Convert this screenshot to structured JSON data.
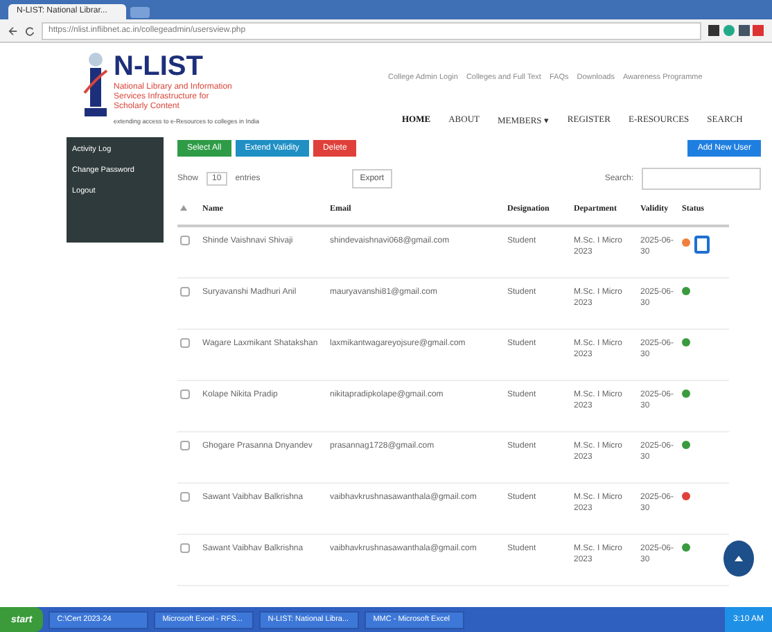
{
  "browser": {
    "tab_title": "N-LIST: National Librar...",
    "url": "https://nlist.inflibnet.ac.in/collegeadmin/usersview.php"
  },
  "header": {
    "logo_title": "N-LIST",
    "logo_subtitle": "National Library and Information Services Infrastructure for Scholarly Content",
    "tagline": "extending access to e-Resources to colleges in India",
    "top_links": [
      "College Admin Login",
      "Colleges and Full Text",
      "FAQs",
      "Downloads",
      "Awareness Programme"
    ],
    "nav": [
      {
        "label": "HOME",
        "selected": true
      },
      {
        "label": "ABOUT",
        "selected": false
      },
      {
        "label": "MEMBERS ▾",
        "selected": false
      },
      {
        "label": "REGISTER",
        "selected": false
      },
      {
        "label": "E-RESOURCES",
        "selected": false
      },
      {
        "label": "SEARCH",
        "selected": false
      }
    ]
  },
  "sidebar": {
    "items": [
      {
        "label": "Activity Log"
      },
      {
        "label": "Change Password"
      },
      {
        "label": "Logout"
      }
    ]
  },
  "actions": [
    {
      "label": "Select All",
      "color": "#2e9c46"
    },
    {
      "label": "Extend Validity",
      "color": "#1f8fc4"
    },
    {
      "label": "Delete",
      "color": "#e0403a"
    }
  ],
  "add_button": "Add New User",
  "show_entries": {
    "prefix": "Show",
    "value": "10",
    "suffix": "entries"
  },
  "export_button": "Export",
  "search_label": "Search:",
  "table": {
    "columns": [
      "Name",
      "Email",
      "Designation",
      "Department",
      "Validity",
      "Status"
    ],
    "rows": [
      {
        "name": "Shinde Vaishnavi Shivaji",
        "email": "shindevaishnavi068@gmail.com",
        "designation": "Student",
        "department": "M.Sc. I Micro 2023",
        "validity": "2025-06-30",
        "checked": false,
        "status": {
          "kind": "toggle",
          "color": "#f0803c"
        }
      },
      {
        "name": "Suryavanshi Madhuri Anil",
        "email": "mauryavanshi81@gmail.com",
        "designation": "Student",
        "department": "M.Sc. I Micro 2023",
        "validity": "2025-06-30",
        "checked": false,
        "status": {
          "kind": "dot",
          "color": "#3a9a3e"
        }
      },
      {
        "name": "Wagare Laxmikant Shatakshan",
        "email": "laxmikantwagareyojsure@gmail.com",
        "designation": "Student",
        "department": "M.Sc. I Micro 2023",
        "validity": "2025-06-30",
        "checked": false,
        "status": {
          "kind": "dot",
          "color": "#3a9a3e"
        }
      },
      {
        "name": "Kolape Nikita Pradip",
        "email": "nikitapradipkolape@gmail.com",
        "designation": "Student",
        "department": "M.Sc. I Micro 2023",
        "validity": "2025-06-30",
        "checked": false,
        "status": {
          "kind": "dot",
          "color": "#3a9a3e"
        }
      },
      {
        "name": "Ghogare Prasanna Dnyandev",
        "email": "prasannag1728@gmail.com",
        "designation": "Student",
        "department": "M.Sc. I Micro 2023",
        "validity": "2025-06-30",
        "checked": false,
        "status": {
          "kind": "dot",
          "color": "#3a9a3e"
        }
      },
      {
        "name": "Sawant Vaibhav Balkrishna",
        "email": "vaibhavkrushnasawanthala@gmail.com",
        "designation": "Student",
        "department": "M.Sc. I Micro 2023",
        "validity": "2025-06-30",
        "checked": false,
        "status": {
          "kind": "dot",
          "color": "#e0403a"
        }
      },
      {
        "name": "Sawant Vaibhav Balkrishna",
        "email": "vaibhavkrushnasawanthala@gmail.com",
        "designation": "Student",
        "department": "M.Sc. I Micro 2023",
        "validity": "2025-06-30",
        "checked": false,
        "status": {
          "kind": "dot",
          "color": "#3a9a3e"
        }
      }
    ]
  },
  "taskbar": {
    "start": "start",
    "items": [
      "C:\\Cert 2023-24",
      "Microsoft Excel - RFS...",
      "N-LIST: National Libra...",
      "MMC - Microsoft Excel"
    ],
    "time": "3:10 AM"
  }
}
